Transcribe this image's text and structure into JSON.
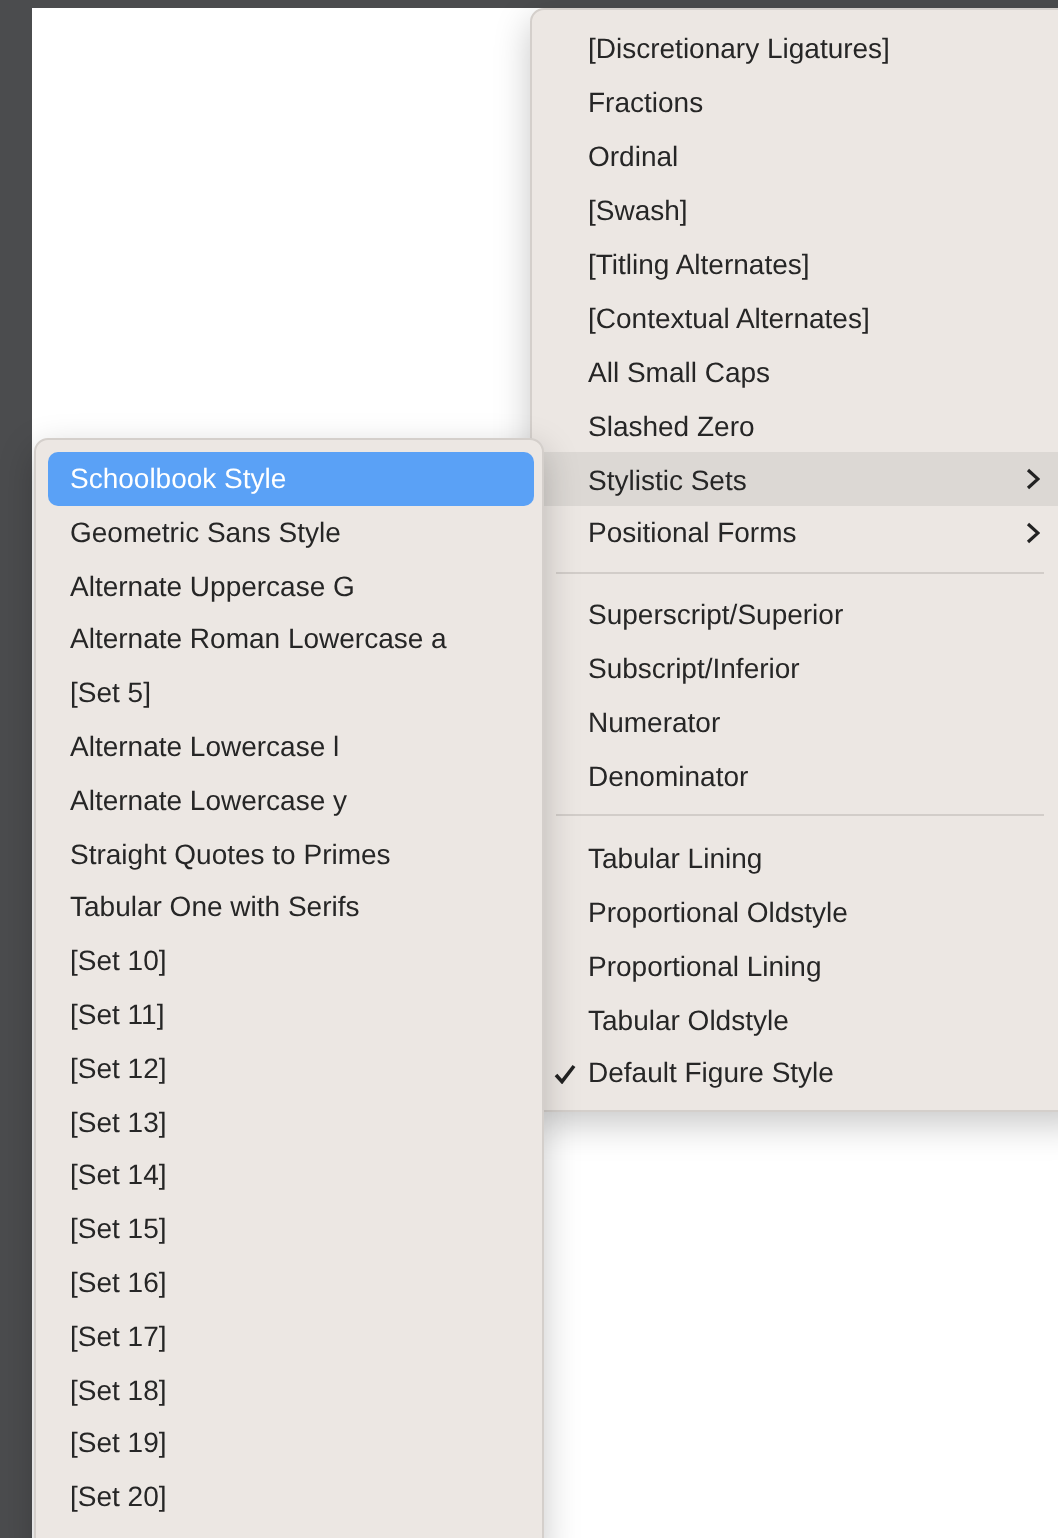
{
  "font_features_menu": {
    "items": [
      {
        "kind": "item",
        "label": "[Discretionary Ligatures]",
        "checked": false,
        "selected": false,
        "submenu": false
      },
      {
        "kind": "item",
        "label": "Fractions",
        "checked": false,
        "selected": false,
        "submenu": false
      },
      {
        "kind": "item",
        "label": "Ordinal",
        "checked": false,
        "selected": false,
        "submenu": false
      },
      {
        "kind": "item",
        "label": "[Swash]",
        "checked": false,
        "selected": false,
        "submenu": false
      },
      {
        "kind": "item",
        "label": "[Titling Alternates]",
        "checked": false,
        "selected": false,
        "submenu": false
      },
      {
        "kind": "item",
        "label": "[Contextual Alternates]",
        "checked": false,
        "selected": false,
        "submenu": false
      },
      {
        "kind": "item",
        "label": "All Small Caps",
        "checked": false,
        "selected": false,
        "submenu": false
      },
      {
        "kind": "item",
        "label": "Slashed Zero",
        "checked": false,
        "selected": false,
        "submenu": false
      },
      {
        "kind": "item",
        "label": "Stylistic Sets",
        "checked": false,
        "selected": true,
        "submenu": true
      },
      {
        "kind": "item",
        "label": "Positional Forms",
        "checked": false,
        "selected": false,
        "submenu": true
      },
      {
        "kind": "separator"
      },
      {
        "kind": "item",
        "label": "Superscript/Superior",
        "checked": false,
        "selected": false,
        "submenu": false
      },
      {
        "kind": "item",
        "label": "Subscript/Inferior",
        "checked": false,
        "selected": false,
        "submenu": false
      },
      {
        "kind": "item",
        "label": "Numerator",
        "checked": false,
        "selected": false,
        "submenu": false
      },
      {
        "kind": "item",
        "label": "Denominator",
        "checked": false,
        "selected": false,
        "submenu": false
      },
      {
        "kind": "separator"
      },
      {
        "kind": "item",
        "label": "Tabular Lining",
        "checked": false,
        "selected": false,
        "submenu": false
      },
      {
        "kind": "item",
        "label": "Proportional Oldstyle",
        "checked": false,
        "selected": false,
        "submenu": false
      },
      {
        "kind": "item",
        "label": "Proportional Lining",
        "checked": false,
        "selected": false,
        "submenu": false
      },
      {
        "kind": "item",
        "label": "Tabular Oldstyle",
        "checked": false,
        "selected": false,
        "submenu": false
      },
      {
        "kind": "item",
        "label": "Default Figure Style",
        "checked": true,
        "selected": false,
        "submenu": false
      }
    ]
  },
  "stylistic_sets_submenu": {
    "items": [
      {
        "label": "Schoolbook Style",
        "selected": true
      },
      {
        "label": "Geometric Sans Style",
        "selected": false
      },
      {
        "label": "Alternate Uppercase G",
        "selected": false
      },
      {
        "label": "Alternate Roman Lowercase a",
        "selected": false
      },
      {
        "label": "[Set 5]",
        "selected": false
      },
      {
        "label": "Alternate Lowercase l",
        "selected": false
      },
      {
        "label": "Alternate Lowercase y",
        "selected": false
      },
      {
        "label": "Straight Quotes to Primes",
        "selected": false
      },
      {
        "label": "Tabular One with Serifs",
        "selected": false
      },
      {
        "label": "[Set 10]",
        "selected": false
      },
      {
        "label": "[Set 11]",
        "selected": false
      },
      {
        "label": "[Set 12]",
        "selected": false
      },
      {
        "label": "[Set 13]",
        "selected": false
      },
      {
        "label": "[Set 14]",
        "selected": false
      },
      {
        "label": "[Set 15]",
        "selected": false
      },
      {
        "label": "[Set 16]",
        "selected": false
      },
      {
        "label": "[Set 17]",
        "selected": false
      },
      {
        "label": "[Set 18]",
        "selected": false
      },
      {
        "label": "[Set 19]",
        "selected": false
      },
      {
        "label": "[Set 20]",
        "selected": false
      }
    ]
  }
}
